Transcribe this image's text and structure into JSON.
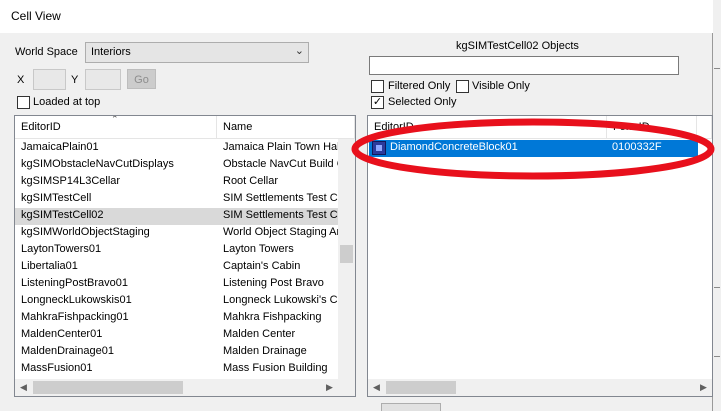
{
  "window": {
    "title": "Cell View"
  },
  "world_space": {
    "label": "World Space",
    "value": "Interiors"
  },
  "coords": {
    "x_label": "X",
    "y_label": "Y",
    "go_label": "Go"
  },
  "loaded_at_top": {
    "label": "Loaded at top",
    "checked": false
  },
  "cell_list": {
    "columns": [
      "EditorID",
      "Name"
    ],
    "rows": [
      {
        "editor_id": "JamaicaPlain01",
        "name": "Jamaica Plain Town Hall"
      },
      {
        "editor_id": "kgSIMObstacleNavCutDisplays",
        "name": "Obstacle NavCut Build Cell"
      },
      {
        "editor_id": "kgSIMSP14L3Cellar",
        "name": "Root Cellar"
      },
      {
        "editor_id": "kgSIMTestCell",
        "name": "SIM Settlements Test Cell"
      },
      {
        "editor_id": "kgSIMTestCell02",
        "name": "SIM Settlements Test Cell"
      },
      {
        "editor_id": "kgSIMWorldObjectStaging",
        "name": "World Object Staging Area"
      },
      {
        "editor_id": "LaytonTowers01",
        "name": "Layton Towers"
      },
      {
        "editor_id": "Libertalia01",
        "name": "Captain's Cabin"
      },
      {
        "editor_id": "ListeningPostBravo01",
        "name": "Listening Post Bravo"
      },
      {
        "editor_id": "LongneckLukowskis01",
        "name": "Longneck Lukowski's Cannery"
      },
      {
        "editor_id": "MahkraFishpacking01",
        "name": "Mahkra Fishpacking"
      },
      {
        "editor_id": "MaldenCenter01",
        "name": "Malden Center"
      },
      {
        "editor_id": "MaldenDrainage01",
        "name": "Malden Drainage"
      },
      {
        "editor_id": "MassFusion01",
        "name": "Mass Fusion Building"
      }
    ],
    "selected_index": 4
  },
  "objects_panel": {
    "title": "kgSIMTestCell02 Objects",
    "filter_value": "",
    "filtered_only": {
      "label": "Filtered Only",
      "checked": false
    },
    "visible_only": {
      "label": "Visible Only",
      "checked": false
    },
    "selected_only": {
      "label": "Selected Only",
      "checked": true
    },
    "columns": [
      "EditorID",
      "FormID"
    ],
    "rows": [
      {
        "editor_id": "DiamondConcreteBlock01",
        "form_id": "0100332F",
        "icon": "object-box-icon"
      }
    ]
  },
  "annotation": {
    "color": "#e8101c"
  },
  "colors": {
    "selection": "#0078d7",
    "row_highlight": "#d9d9d9"
  }
}
